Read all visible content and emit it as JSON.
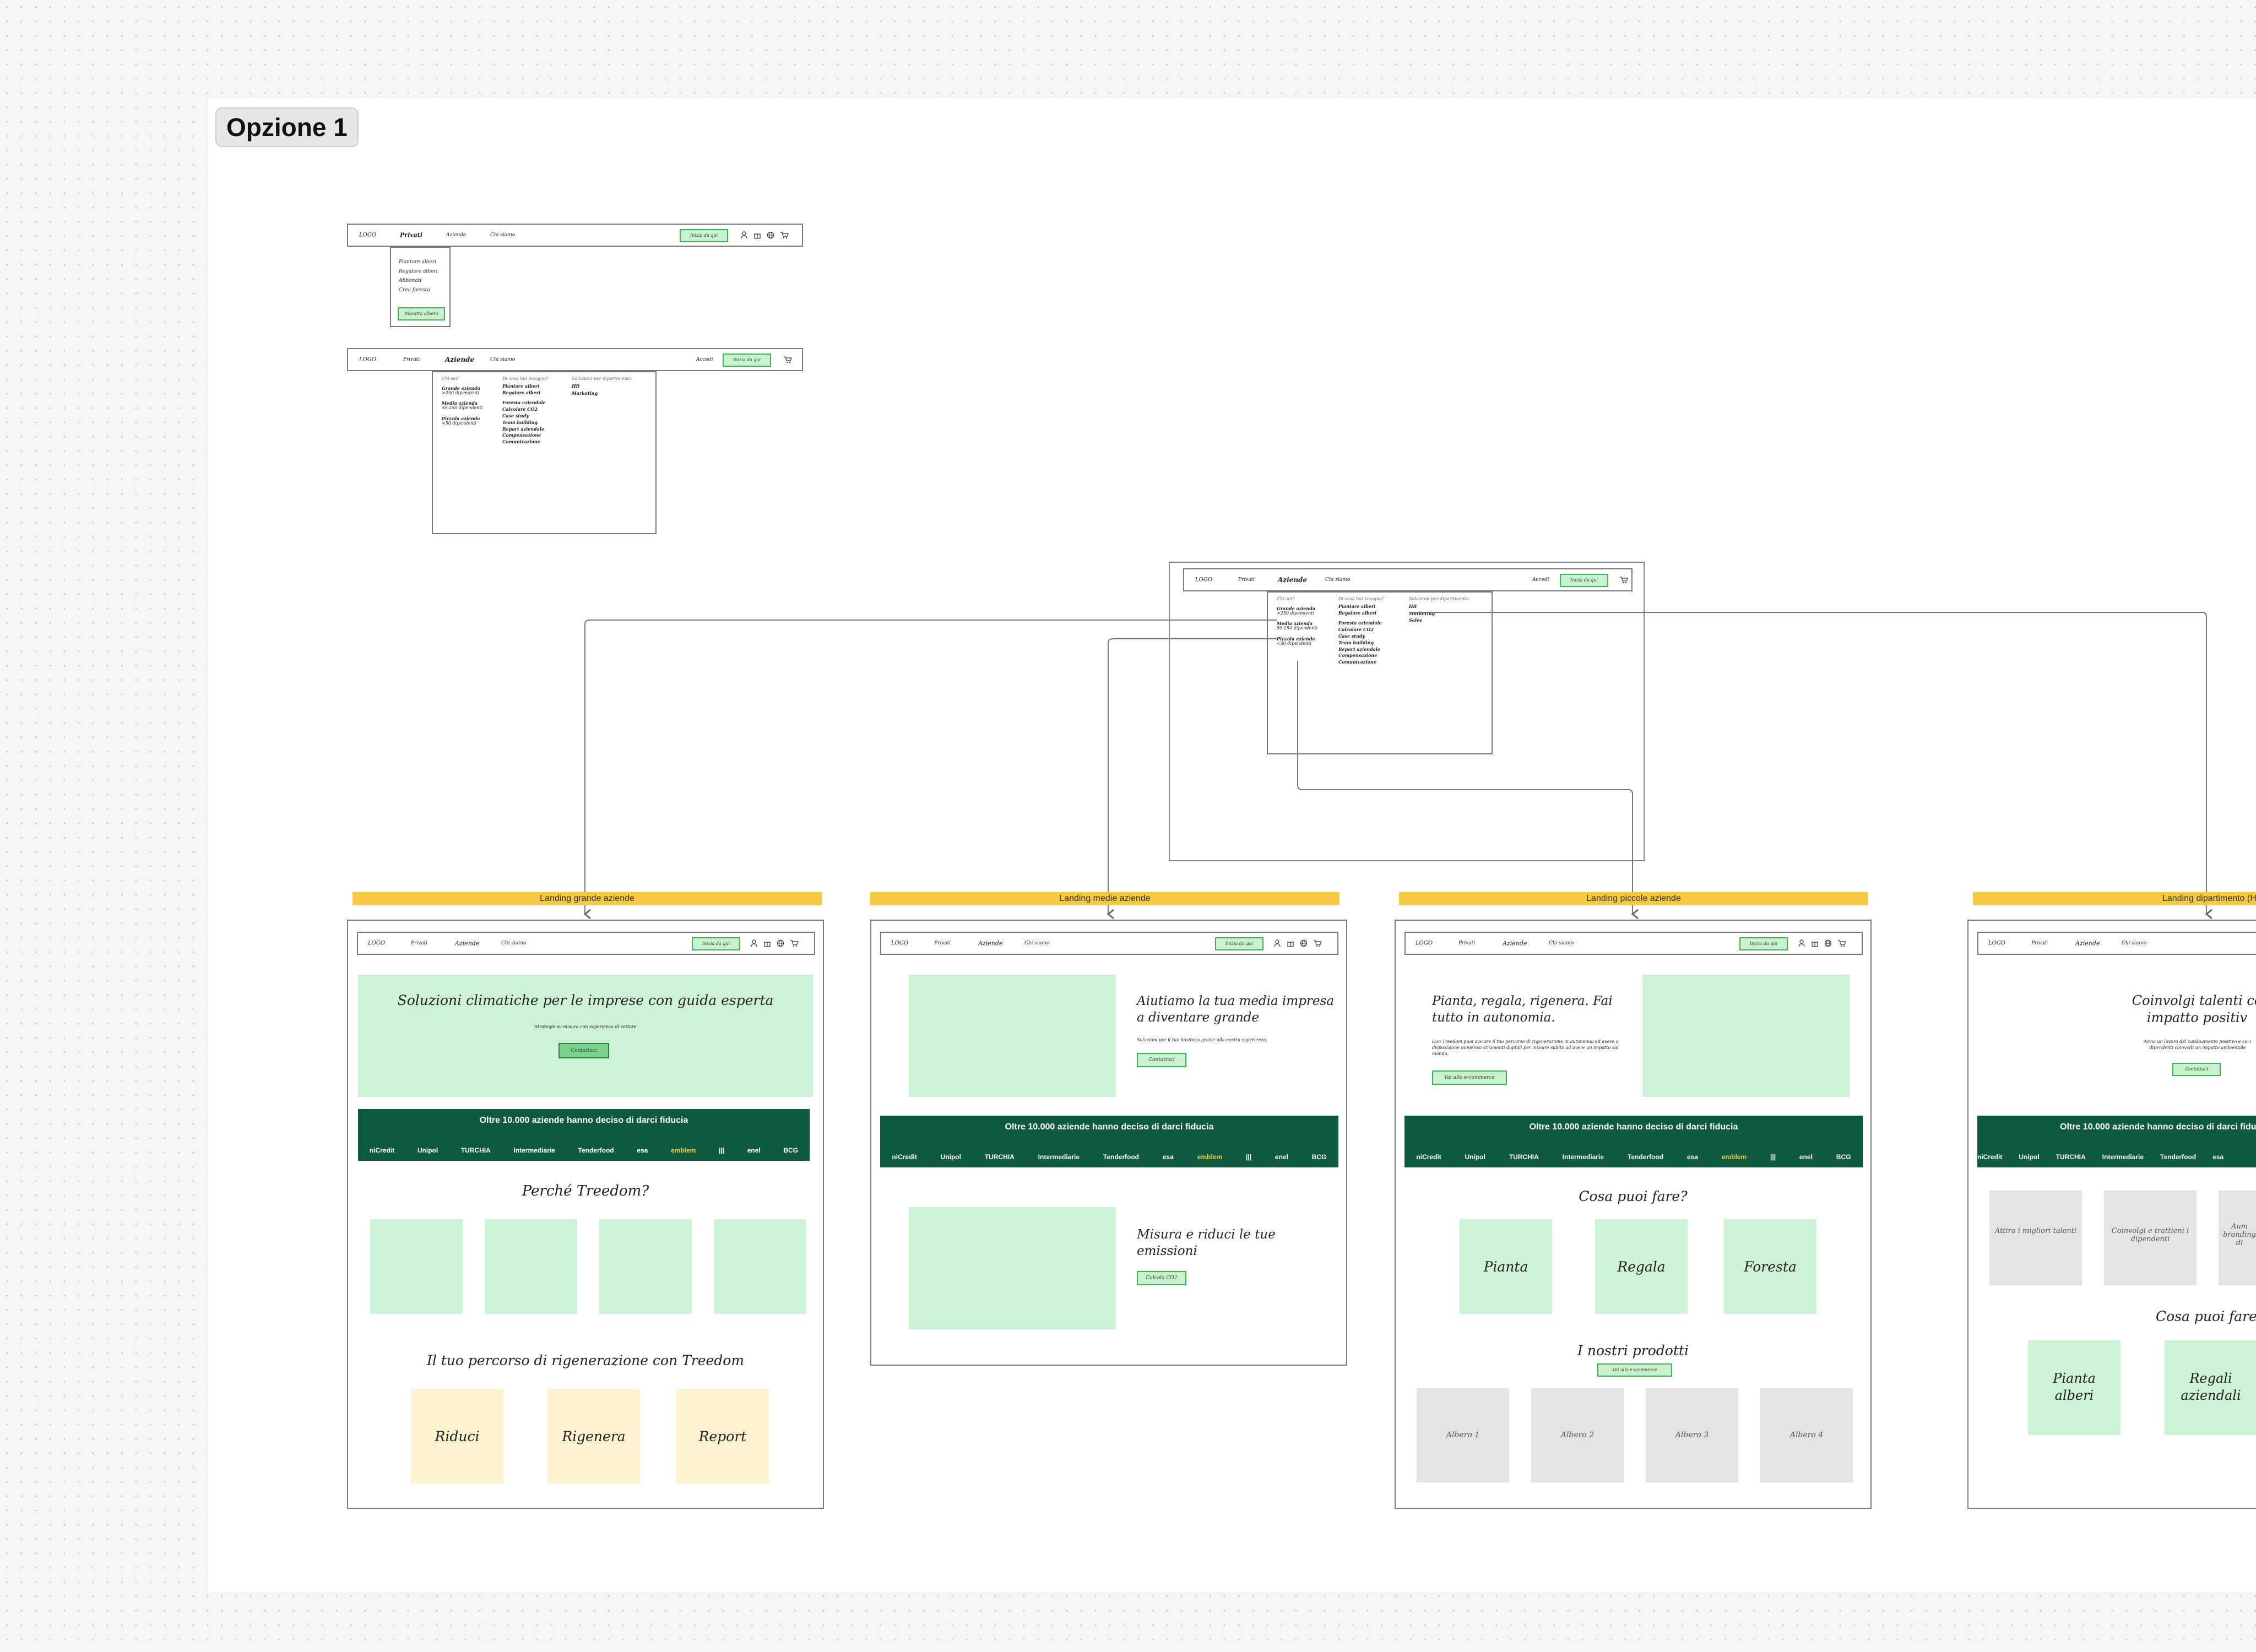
{
  "page_title": "Opzione 1",
  "nav": {
    "logo": "LOGO",
    "privati": "Privati",
    "aziende": "Aziende",
    "chi_siamo": "Chi siamo",
    "accedi": "Accedi",
    "cta": "Inizia da qui"
  },
  "privati_dropdown": {
    "items": [
      "Piantare alberi",
      "Regalare alberi",
      "Abbonati",
      "Crea foresta"
    ],
    "cta": "Riscatta albero"
  },
  "aziende_menu": {
    "col1_title": "Chi sei?",
    "col1_items": [
      {
        "title": "Grande azienda",
        "sub": ">250 dipendenti"
      },
      {
        "title": "Media azienda",
        "sub": "50-250 dipendenti"
      },
      {
        "title": "Piccola azienda",
        "sub": "<50 dipendenti"
      }
    ],
    "col2_title": "Di cosa hai bisogno?",
    "col2_items": [
      "Piantare alberi",
      "Regalare alberi",
      "Foresta aziendale",
      "Calcolare CO2",
      "Case study",
      "Team building",
      "Report aziendale",
      "Compensazione",
      "Comunicazione"
    ],
    "col3_title": "Soluzioni per dipartimento",
    "col3_items_small": [
      "HR",
      "Marketing"
    ],
    "col3_items_large": [
      "HR",
      "Marketing",
      "Sales"
    ]
  },
  "landing_labels": [
    "Landing grande aziende",
    "Landing medie aziende",
    "Landing piccole aziende",
    "Landing dipartimento (HR)"
  ],
  "trust": {
    "title": "Oltre 10.000 aziende hanno deciso di darci fiducia",
    "logos": [
      "niCredit",
      "Unipol",
      "TURCHIA",
      "Intermediarie",
      "Tenderfood",
      "esa",
      "emblem",
      "|||",
      "enel",
      "BCG"
    ]
  },
  "landing_grande": {
    "hero_title": "Soluzioni climatiche per le imprese con guida esperta",
    "hero_sub": "Strategie su misura con esperienza di settore",
    "hero_cta": "Contattaci",
    "why_title": "Perché Treedom?",
    "path_title": "Il tuo percorso di rigenerazione con Treedom",
    "path_cards": [
      "Riduci",
      "Rigenera",
      "Report"
    ]
  },
  "landing_medie": {
    "hero_title": "Aiutiamo la tua media impresa a diventare grande",
    "hero_sub": "Soluzioni per il tuo business grazie alla nostra esperienza.",
    "hero_cta": "Contattaci",
    "sec2_title": "Misura e riduci le tue emissioni",
    "sec2_cta": "Calcola CO2"
  },
  "landing_piccole": {
    "hero_title": "Pianta, regala, rigenera. Fai tutto in autonomia.",
    "hero_sub": "Con Treedom puoi avviare il tuo percorso di rigenerazione in autonomia ed avere a disposizione numerosi strumenti digitali per iniziare subito ad avere un impatto sul mondo.",
    "hero_cta": "Vai allo e-commerce",
    "cosa_title": "Cosa puoi fare?",
    "cosa_cards": [
      "Pianta",
      "Regala",
      "Foresta"
    ],
    "prodotti_title": "I nostri prodotti",
    "prodotti_cta": "Vai allo e-commerce",
    "prodotti": [
      "Albero 1",
      "Albero 2",
      "Albero 3",
      "Albero 4"
    ]
  },
  "landing_hr": {
    "hero_title": "Coinvolgi talenti co impatto positiv",
    "hero_sub": "Avvia un lavoro del cambiamento positivo e coi i dipendenti coinvolti un impatto ambientale",
    "hero_cta": "Contattaci",
    "cards": [
      "Attira i migliori talenti",
      "Coinvolgi e trattieni i dipendenti",
      "Aum branding di"
    ],
    "cosa_title": "Cosa puoi fare?",
    "cosa_cards": [
      "Pianta alberi",
      "Regali aziendali"
    ]
  },
  "colors": {
    "accent_green": "#c9f1cf",
    "dark_green": "#0e5a3f",
    "label_yellow": "#f7c842",
    "soft_yellow": "#fdf3cf"
  }
}
